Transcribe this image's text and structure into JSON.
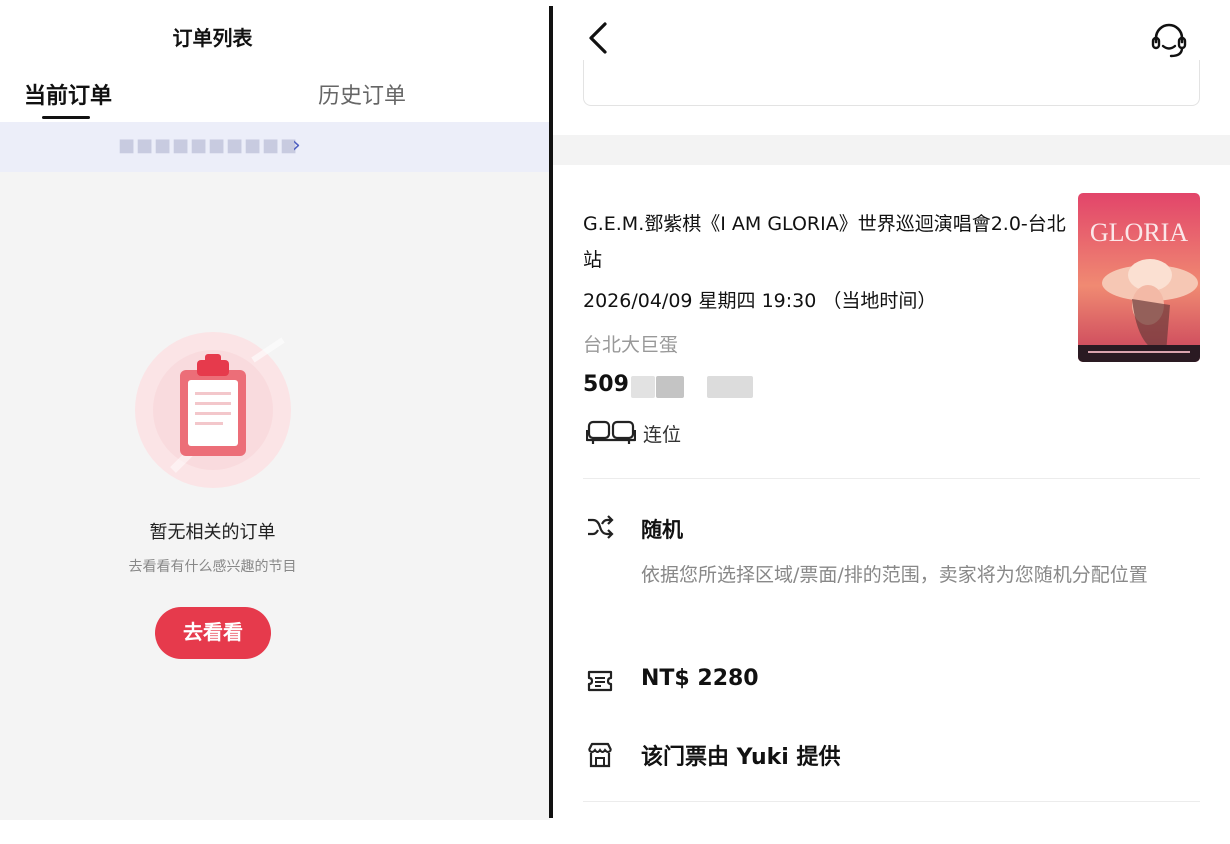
{
  "left": {
    "title": "订单列表",
    "tabs": [
      {
        "label": "当前订单",
        "active": true
      },
      {
        "label": "历史订单",
        "active": false
      }
    ],
    "notice_text": "■■■■■■■■■■",
    "empty": {
      "title": "暂无相关的订单",
      "subtitle": "去看看有什么感兴趣的节目",
      "button": "去看看"
    }
  },
  "right": {
    "event": {
      "title": "G.E.M.鄧紫棋《I AM GLORIA》世界巡迴演唱會2.0-台北站",
      "datetime": "2026/04/09 星期四 19:30 （当地时间）",
      "venue": "台北大巨蛋",
      "seat_prefix": "509",
      "adjacent_label": "连位",
      "poster_text": "GLORIA"
    },
    "random": {
      "label": "随机",
      "desc": "依据您所选择区域/票面/排的范围，卖家将为您随机分配位置"
    },
    "price": "NT$ 2280",
    "provider": "该门票由 Yuki 提供"
  },
  "colors": {
    "accent_red": "#e63a4c",
    "notice_bg": "#eceef9",
    "page_bg": "#f4f4f4"
  },
  "icons": [
    "back-arrow-icon",
    "customer-service-icon",
    "clipboard-icon",
    "seats-icon",
    "shuffle-icon",
    "ticket-icon",
    "store-icon",
    "chevron-right-icon"
  ]
}
